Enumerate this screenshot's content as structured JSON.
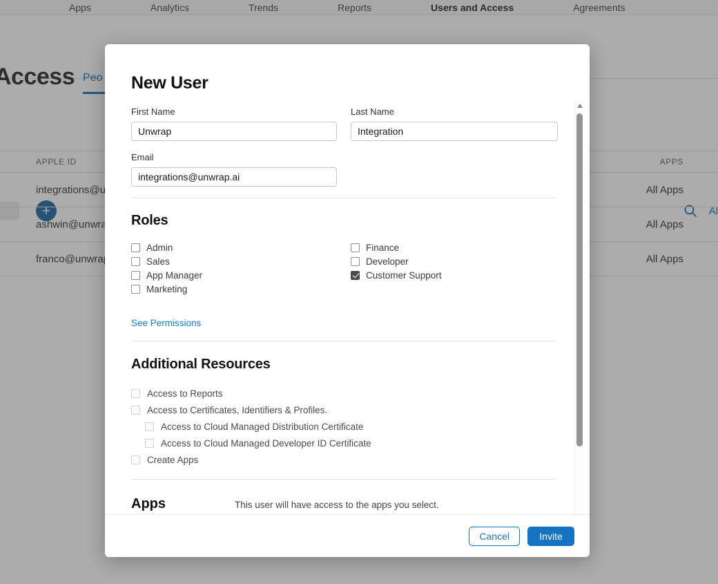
{
  "background": {
    "nav": {
      "items": [
        {
          "label": "Apps",
          "active": false
        },
        {
          "label": "Analytics",
          "active": false
        },
        {
          "label": "Trends",
          "active": false
        },
        {
          "label": "Reports",
          "active": false
        },
        {
          "label": "Users and Access",
          "active": true
        },
        {
          "label": "Agreements",
          "active": false
        }
      ]
    },
    "page_title": "Access",
    "tab_label": "Peo",
    "add_button_label": "+",
    "all_label": "Al",
    "table": {
      "columns": [
        "APPLE ID",
        "APPS"
      ],
      "rows": [
        {
          "apple_id": "integrations@un",
          "apps": "All Apps"
        },
        {
          "apple_id": "ashwin@unwrap.",
          "apps": "All Apps"
        },
        {
          "apple_id": "franco@unwrap.a",
          "apps": "All Apps"
        }
      ]
    }
  },
  "modal": {
    "title": "New User",
    "fields": {
      "first_name": {
        "label": "First Name",
        "value": "Unwrap",
        "placeholder": ""
      },
      "last_name": {
        "label": "Last Name",
        "value": "Integration",
        "placeholder": ""
      },
      "email": {
        "label": "Email",
        "value": "integrations@unwrap.ai",
        "placeholder": ""
      }
    },
    "roles": {
      "title": "Roles",
      "left": [
        {
          "label": "Admin",
          "checked": false
        },
        {
          "label": "Sales",
          "checked": false
        },
        {
          "label": "App Manager",
          "checked": false
        },
        {
          "label": "Marketing",
          "checked": false
        }
      ],
      "right": [
        {
          "label": "Finance",
          "checked": false
        },
        {
          "label": "Developer",
          "checked": false
        },
        {
          "label": "Customer Support",
          "checked": true
        }
      ],
      "see_permissions_label": "See Permissions"
    },
    "additional_resources": {
      "title": "Additional Resources",
      "items": [
        {
          "label": "Access to Reports",
          "checked": false,
          "disabled": true,
          "indent": false
        },
        {
          "label": "Access to Certificates, Identifiers & Profiles.",
          "checked": false,
          "disabled": true,
          "indent": false
        },
        {
          "label": "Access to Cloud Managed Distribution Certificate",
          "checked": false,
          "disabled": true,
          "indent": true
        },
        {
          "label": "Access to Cloud Managed Developer ID Certificate",
          "checked": false,
          "disabled": true,
          "indent": true
        },
        {
          "label": "Create Apps",
          "checked": false,
          "disabled": true,
          "indent": false
        }
      ]
    },
    "apps": {
      "title": "Apps",
      "note": "This user will have access to the apps you select.",
      "select_value": ""
    },
    "footer": {
      "cancel_label": "Cancel",
      "invite_label": "Invite"
    }
  },
  "colors": {
    "accent_blue": "#1573c4",
    "link_blue": "#1280d4",
    "nav_blue": "#0a64a8",
    "checked_checkbox": "#4b4b4b"
  }
}
